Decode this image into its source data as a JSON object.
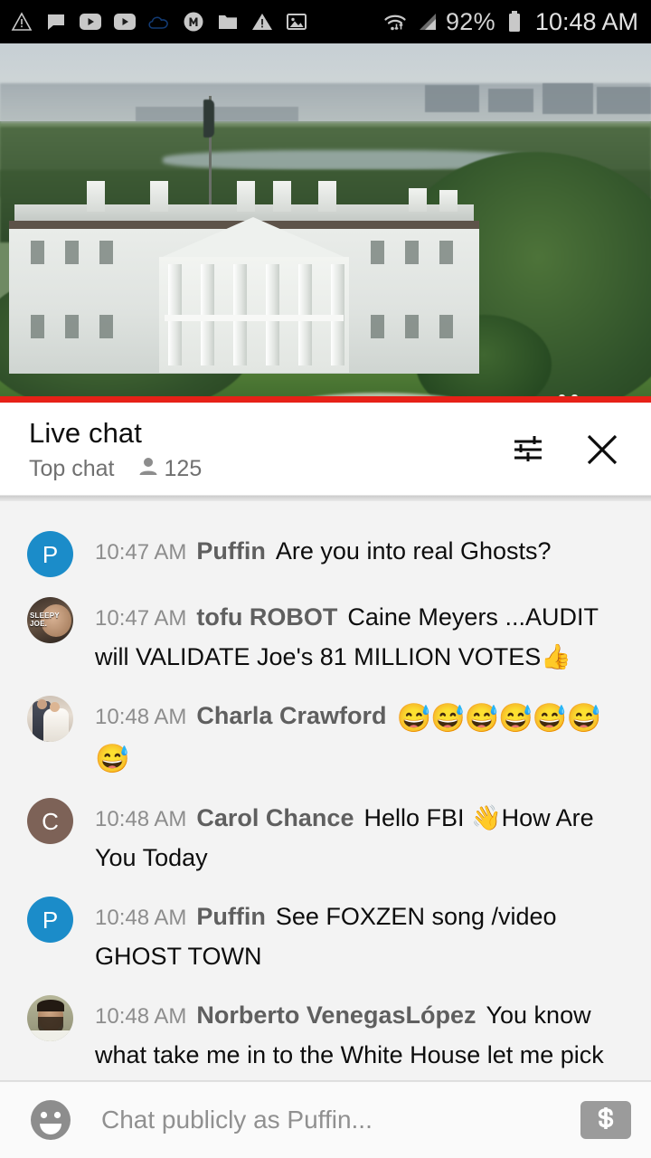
{
  "status_bar": {
    "icons": [
      "warning-outline-icon",
      "chat-bubble-icon",
      "youtube-play-icon",
      "youtube-play-icon-2",
      "cloud-icon",
      "m-circle-icon",
      "folder-icon",
      "warning-filled-icon",
      "image-icon"
    ],
    "wifi_icon": "wifi-data-icon",
    "signal_icon": "signal-bars-icon",
    "battery_percent": "92%",
    "battery_icon": "battery-icon",
    "time": "10:48 AM"
  },
  "video": {
    "description": "White House live stream",
    "progress_color": "#e62117",
    "progress_percent": 100
  },
  "chat_header": {
    "title": "Live chat",
    "subtitle": "Top chat",
    "viewer_icon": "person-icon",
    "viewer_count": "125",
    "tune_icon": "tune-icon",
    "close_icon": "close-icon"
  },
  "chat": {
    "clipped_top_message": "g g",
    "messages": [
      {
        "time": "10:47 AM",
        "author": "Puffin",
        "text": "Are you into real Ghosts?",
        "avatar_type": "initial",
        "avatar_initial": "P",
        "avatar_color": "#1b8cc9"
      },
      {
        "time": "10:47 AM",
        "author": "tofu ROBOT",
        "text": "Caine Meyers ...AUDIT will VALIDATE Joe's 81 MILLION VOTES👍",
        "avatar_type": "photo-joe",
        "avatar_label": "SLEEPY JOE."
      },
      {
        "time": "10:48 AM",
        "author": "Charla Crawford",
        "text": "😅😅😅😅😅😅😅",
        "avatar_type": "photo-wedding"
      },
      {
        "time": "10:48 AM",
        "author": "Carol Chance",
        "text": "Hello FBI 👋How Are You Today",
        "avatar_type": "initial",
        "avatar_initial": "C",
        "avatar_color": "#7d6257"
      },
      {
        "time": "10:48 AM",
        "author": "Puffin",
        "text": "See FOXZEN song /video GHOST TOWN",
        "avatar_type": "initial",
        "avatar_initial": "P",
        "avatar_color": "#1b8cc9"
      },
      {
        "time": "10:48 AM",
        "author": "Norberto VenegasLópez",
        "text": "You know what take me in to the White House let me pick up my stuff their",
        "avatar_type": "photo-norberto"
      }
    ]
  },
  "chat_input": {
    "emoji_icon": "emoji-smiley-icon",
    "placeholder": "Chat publicly as Puffin...",
    "superchat_icon": "dollar-sign-icon"
  }
}
